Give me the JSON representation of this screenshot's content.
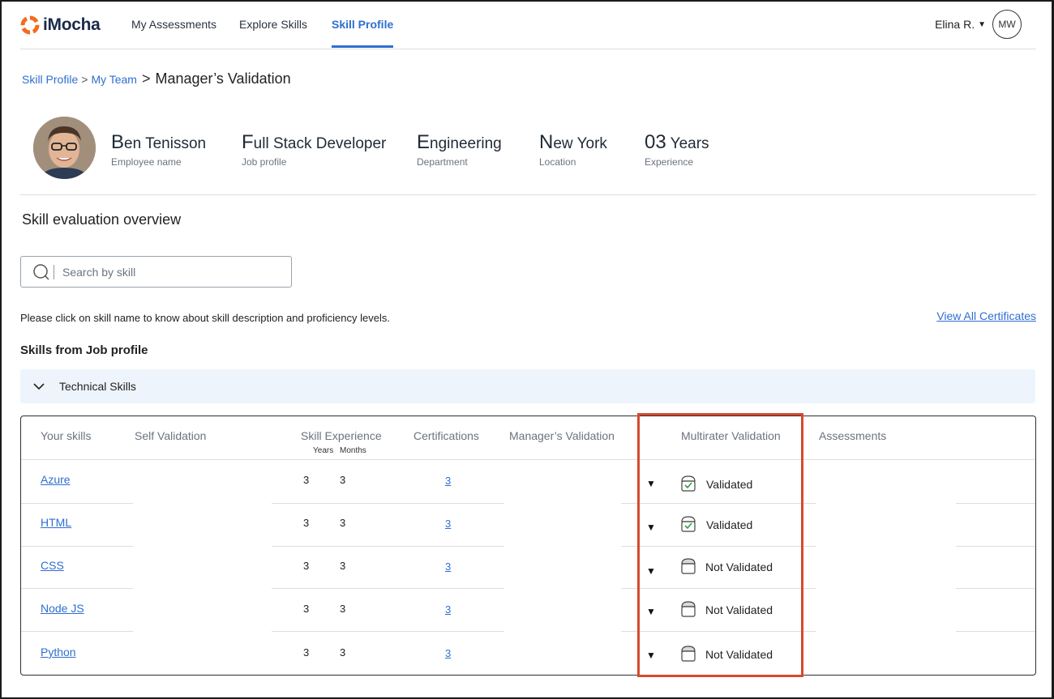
{
  "app": {
    "logo_text": "iMocha",
    "colors": {
      "accent": "#2f6fd1",
      "logo_orange": "#f26b21",
      "highlight": "#d64a2e",
      "validated_check": "#2e9e49"
    }
  },
  "nav": {
    "items": [
      {
        "label": "My Assessments"
      },
      {
        "label": "Explore Skills"
      },
      {
        "label": "Skill Profile",
        "active": true
      }
    ],
    "user_name": "Elina R.",
    "user_initials": "MW"
  },
  "breadcrumb": {
    "items": [
      "Skill Profile",
      "My Team"
    ],
    "current": "Manager’s Validation"
  },
  "profile": {
    "name": {
      "first": "B",
      "rest": "en Tenisson",
      "label": "Employee name"
    },
    "job": {
      "first": "F",
      "rest": "ull Stack Developer",
      "label": "Job profile"
    },
    "department": {
      "first": "E",
      "rest": "ngineering",
      "label": "Department"
    },
    "location": {
      "first": "N",
      "rest": "ew York",
      "label": "Location"
    },
    "experience": {
      "first": "03",
      "rest": " Years",
      "label": "Experience"
    }
  },
  "overview": {
    "title": "Skill evaluation overview",
    "search_placeholder": "Search by skill",
    "hint": "Please click on skill name to know about skill description and proficiency levels.",
    "view_all": "View All Certificates",
    "skills_heading": "Skills from Job profile",
    "accordion_label": "Technical Skills"
  },
  "table": {
    "headers": {
      "skills": "Your skills",
      "self": "Self Validation",
      "experience": "Skill Experience",
      "exp_years": "Years",
      "exp_months": "Months",
      "certs": "Certifications",
      "manager": "Manager’s Validation",
      "multirater": "Multirater Validation",
      "assessments": "Assessments"
    },
    "rows": [
      {
        "skill": "Azure",
        "years": "3",
        "months": "3",
        "certs": "3",
        "multirater": "Validated",
        "validated": true
      },
      {
        "skill": "HTML",
        "years": "3",
        "months": "3",
        "certs": "3",
        "multirater": "Validated",
        "validated": true
      },
      {
        "skill": "CSS",
        "years": "3",
        "months": "3",
        "certs": "3",
        "multirater": "Not Validated",
        "validated": false
      },
      {
        "skill": "Node JS",
        "years": "3",
        "months": "3",
        "certs": "3",
        "multirater": "Not Validated",
        "validated": false
      },
      {
        "skill": "Python",
        "years": "3",
        "months": "3",
        "certs": "3",
        "multirater": "Not Validated",
        "validated": false
      }
    ]
  }
}
